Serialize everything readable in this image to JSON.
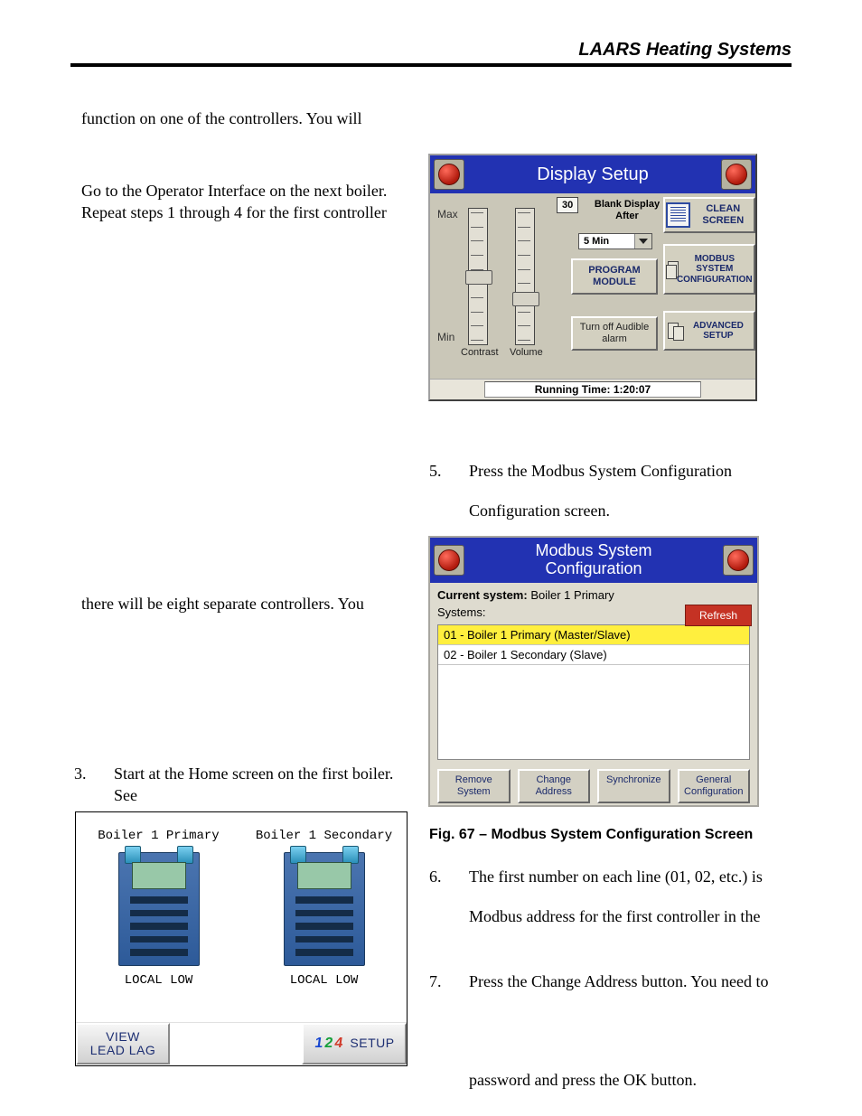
{
  "header": "LAARS Heating Systems",
  "leftCol": {
    "p1": "function on one of the controllers.  You will",
    "p2": "Go to the Operator Interface on the next boiler. Repeat steps 1 through 4 for the first controller",
    "p3": "there will be eight separate controllers.  You",
    "item3_num": "3.",
    "item3_text": "Start at the Home screen on the first boiler.  See"
  },
  "rightCol": {
    "item5_num": "5.",
    "item5_line1": "Press the Modbus System Configuration",
    "item5_line2": "Configuration screen.",
    "figCaption": "Fig. 67 – Modbus System Configuration Screen",
    "item6_num": "6.",
    "item6_line1": "The first number on each line (01, 02, etc.) is",
    "item6_line2": "Modbus address for the first controller in the",
    "item7_num": "7.",
    "item7_line1": "Press the Change Address button. You need to",
    "item7_line2": "password and press the OK button."
  },
  "displaySetup": {
    "title": "Display Setup",
    "max": "Max",
    "min": "Min",
    "contrast": "Contrast",
    "volume": "Volume",
    "numVal": "30",
    "blankAfter": "Blank Display After",
    "dropdown": "5 Min",
    "programModule": "PROGRAM MODULE",
    "turnOff": "Turn off Audible alarm",
    "cleanScreen": "CLEAN SCREEN",
    "modbusCfg": "MODBUS SYSTEM CONFIGURATION",
    "advSetup": "ADVANCED SETUP",
    "running": "Running Time: 1:20:07"
  },
  "modbus": {
    "title1": "Modbus System",
    "title2": "Configuration",
    "curSysLabel": "Current system:",
    "curSysVal": "Boiler 1 Primary",
    "systemsLabel": "Systems:",
    "refresh": "Refresh",
    "row1": "01 - Boiler 1 Primary (Master/Slave)",
    "row2": "02 - Boiler 1 Secondary (Slave)",
    "btnRemove": "Remove System",
    "btnChange": "Change Address",
    "btnSync": "Synchronize",
    "btnGeneral": "General Configuration"
  },
  "home": {
    "col1": "Boiler 1 Primary",
    "col2": "Boiler 1 Secondary",
    "local": "LOCAL LOW",
    "viewLeadLag": "VIEW\nLEAD LAG",
    "setup": "SETUP"
  }
}
